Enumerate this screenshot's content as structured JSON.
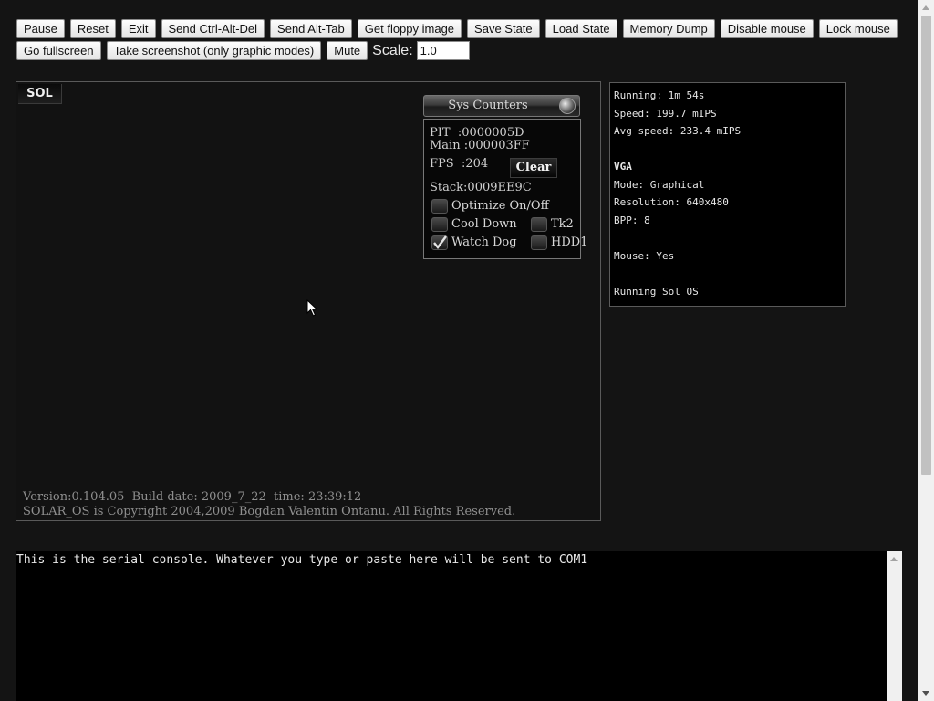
{
  "toolbar": {
    "row1": [
      {
        "name": "pause-button",
        "label": "Pause"
      },
      {
        "name": "reset-button",
        "label": "Reset"
      },
      {
        "name": "exit-button",
        "label": "Exit"
      },
      {
        "name": "send-ctrl-alt-del-button",
        "label": "Send Ctrl-Alt-Del"
      },
      {
        "name": "send-alt-tab-button",
        "label": "Send Alt-Tab"
      },
      {
        "name": "get-floppy-image-button",
        "label": "Get floppy image"
      },
      {
        "name": "save-state-button",
        "label": "Save State"
      },
      {
        "name": "load-state-button",
        "label": "Load State"
      },
      {
        "name": "memory-dump-button",
        "label": "Memory Dump"
      },
      {
        "name": "disable-mouse-button",
        "label": "Disable mouse"
      },
      {
        "name": "lock-mouse-button",
        "label": "Lock mouse"
      }
    ],
    "row2": [
      {
        "name": "go-fullscreen-button",
        "label": "Go fullscreen"
      },
      {
        "name": "take-screenshot-button",
        "label": "Take screenshot (only graphic modes)"
      },
      {
        "name": "mute-button",
        "label": "Mute"
      }
    ],
    "scale_label": "Scale:",
    "scale_value": "1.0"
  },
  "screen": {
    "tab_label": "SOL",
    "sys_counters": {
      "title": "Sys Counters",
      "pit_line": "PIT  :0000005D",
      "main_line": "Main :000003FF",
      "fps_line": "FPS  :204",
      "clear_label": "Clear",
      "stack_line": "Stack:0009EE9C",
      "options": [
        {
          "name": "optimize-checkbox",
          "label": "Optimize On/Off",
          "checked": false
        },
        {
          "name": "cool-down-checkbox",
          "label": "Cool Down",
          "checked": false
        },
        {
          "name": "tk2-checkbox",
          "label": "Tk2",
          "checked": false
        },
        {
          "name": "watch-dog-checkbox",
          "label": "Watch Dog",
          "checked": true
        },
        {
          "name": "hdd1-checkbox",
          "label": "HDD1",
          "checked": false
        }
      ]
    },
    "footer": {
      "line1": "Version:0.104.05  Build date: 2009_7_22  time: 23:39:12",
      "line2": "SOLAR_OS is Copyright 2004,2009 Bogdan Valentin Ontanu. All Rights Reserved."
    }
  },
  "status": {
    "running": "Running: 1m 54s",
    "speed": "Speed: 199.7 mIPS",
    "avg_speed": "Avg speed: 233.4 mIPS",
    "vga_header": "VGA",
    "mode": "Mode: Graphical",
    "resolution": "Resolution: 640x480",
    "bpp": "BPP: 8",
    "mouse": "Mouse: Yes",
    "os": "Running Sol OS"
  },
  "console": {
    "text": "This is the serial console. Whatever you type or paste here will be sent to COM1"
  }
}
